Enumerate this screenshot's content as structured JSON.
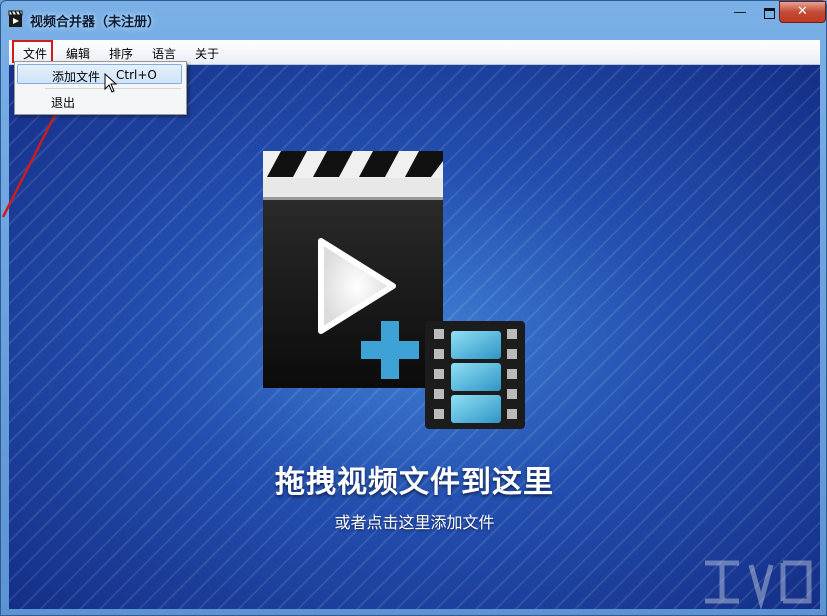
{
  "window": {
    "title": "视频合并器（未注册）",
    "controls": {
      "minimize": "—",
      "close": "✕"
    }
  },
  "menubar": {
    "items": [
      {
        "label": "文件"
      },
      {
        "label": "编辑"
      },
      {
        "label": "排序"
      },
      {
        "label": "语言"
      },
      {
        "label": "关于"
      }
    ]
  },
  "file_menu": {
    "items": [
      {
        "label": "添加文件",
        "shortcut": "Ctrl+O"
      },
      {
        "label": "退出"
      }
    ]
  },
  "dropzone": {
    "title": "拖拽视频文件到这里",
    "subtitle": "或者点击这里添加文件"
  },
  "colors": {
    "highlight": "#d21c1c",
    "background": "#234fb0",
    "plus": "#3fa2d6"
  }
}
